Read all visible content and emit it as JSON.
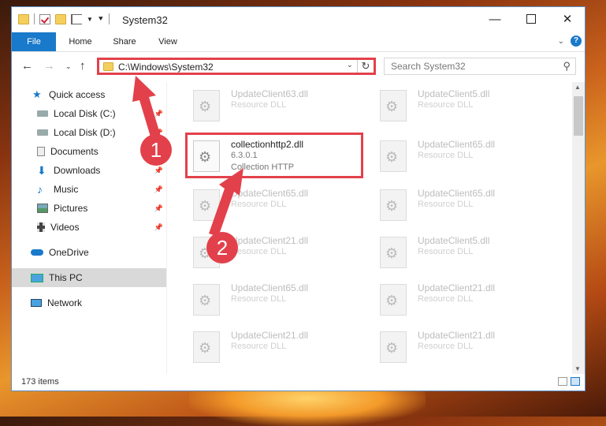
{
  "titlebar": {
    "title": "System32",
    "minimize_icon": "minimize-icon",
    "maximize_icon": "maximize-icon",
    "close_icon": "close-icon"
  },
  "ribbon": {
    "tabs": [
      {
        "label": "File"
      },
      {
        "label": "Home"
      },
      {
        "label": "Share"
      },
      {
        "label": "View"
      }
    ],
    "help": "?"
  },
  "nav": {
    "address": "C:\\Windows\\System32",
    "search_placeholder": "Search System32"
  },
  "sidebar": {
    "items": [
      {
        "label": "Quick access",
        "icon": "star-icon"
      },
      {
        "label": "Local Disk (C:)",
        "icon": "drive-icon"
      },
      {
        "label": "Local Disk (D:)",
        "icon": "drive-icon"
      },
      {
        "label": "Documents",
        "icon": "documents-icon"
      },
      {
        "label": "Downloads",
        "icon": "download-icon"
      },
      {
        "label": "Music",
        "icon": "music-icon"
      },
      {
        "label": "Pictures",
        "icon": "pictures-icon"
      },
      {
        "label": "Videos",
        "icon": "videos-icon"
      },
      {
        "label": "OneDrive",
        "icon": "cloud-icon"
      },
      {
        "label": "This PC",
        "icon": "computer-icon"
      },
      {
        "label": "Network",
        "icon": "network-icon"
      }
    ]
  },
  "files": {
    "left": [
      {
        "name": "UpdateClient63.dll",
        "type": "Resource DLL"
      },
      {
        "name": "collectionhttp2.dll",
        "version": "6.3.0.1",
        "type": "Collection HTTP"
      },
      {
        "name": "UpdateClient65.dll",
        "type": "Resource DLL"
      },
      {
        "name": "UpdateClient21.dll",
        "type": "Resource DLL"
      },
      {
        "name": "UpdateClient65.dll",
        "type": "Resource DLL"
      },
      {
        "name": "UpdateClient21.dll",
        "type": "Resource DLL"
      }
    ],
    "right": [
      {
        "name": "UpdateClient5.dll",
        "type": "Resource DLL"
      },
      {
        "name": "UpdateClient65.dll",
        "type": "Resource DLL"
      },
      {
        "name": "UpdateClient65.dll",
        "type": "Resource DLL"
      },
      {
        "name": "UpdateClient5.dll",
        "type": "Resource DLL"
      },
      {
        "name": "UpdateClient21.dll",
        "type": "Resource DLL"
      },
      {
        "name": "UpdateClient21.dll",
        "type": "Resource DLL"
      }
    ]
  },
  "status": {
    "count": "173 items"
  },
  "annotations": {
    "badge1": "1",
    "badge2": "2",
    "highlight_color": "#e2414b"
  }
}
